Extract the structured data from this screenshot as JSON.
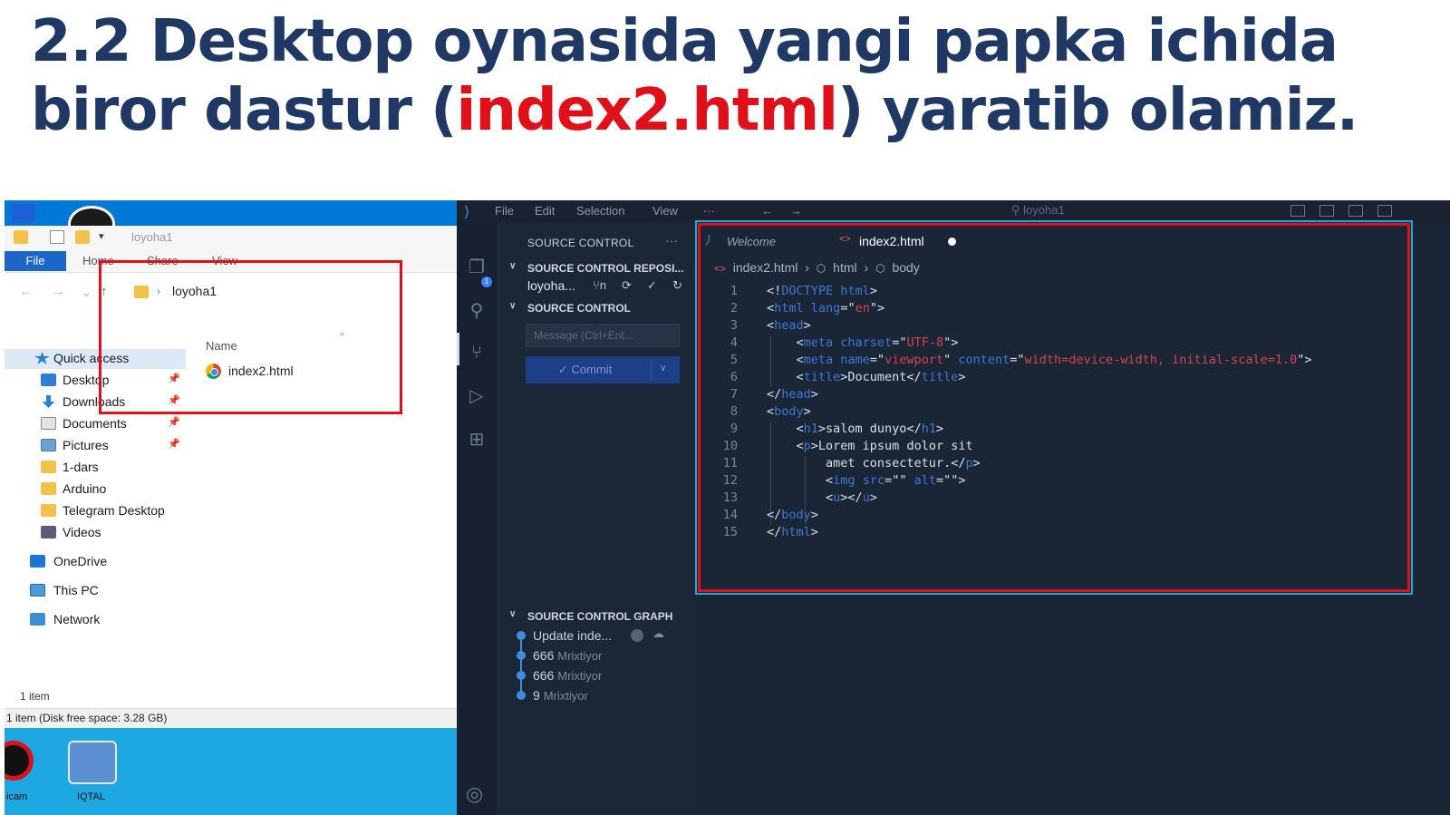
{
  "slide": {
    "title_part1": "2.2 Desktop oynasida yangi papka ichida biror dastur (",
    "title_highlight": "index2.html",
    "title_part2": ") yaratib olamiz."
  },
  "explorer": {
    "window_title": "loyoha1",
    "ribbon_tabs": [
      "File",
      "Home",
      "Share",
      "View"
    ],
    "address": "loyoha1",
    "sidebar": [
      {
        "label": "Quick access",
        "icon": "star-icon",
        "pinned": false
      },
      {
        "label": "Desktop",
        "icon": "desktop-icon",
        "pinned": true
      },
      {
        "label": "Downloads",
        "icon": "download-icon",
        "pinned": true
      },
      {
        "label": "Documents",
        "icon": "documents-icon",
        "pinned": true
      },
      {
        "label": "Pictures",
        "icon": "pictures-icon",
        "pinned": true
      },
      {
        "label": "1-dars",
        "icon": "folder-icon",
        "pinned": false
      },
      {
        "label": "Arduino",
        "icon": "folder-icon",
        "pinned": false
      },
      {
        "label": "Telegram Desktop",
        "icon": "folder-icon",
        "pinned": false
      },
      {
        "label": "Videos",
        "icon": "videos-icon",
        "pinned": false
      },
      {
        "label": "OneDrive",
        "icon": "onedrive-icon",
        "pinned": false
      },
      {
        "label": "This PC",
        "icon": "computer-icon",
        "pinned": false
      },
      {
        "label": "Network",
        "icon": "network-icon",
        "pinned": false
      }
    ],
    "column_header": "Name",
    "file_name": "index2.html",
    "item_count": "1 item",
    "status": "1 item (Disk free space: 3.28 GB)",
    "taskbar_labels": [
      "icam",
      "IQTAL"
    ]
  },
  "vscode": {
    "menu": [
      "File",
      "Edit",
      "Selection",
      "View",
      "···"
    ],
    "search": "loyoha1",
    "activity_badge": "1",
    "sidebar": {
      "header": "SOURCE CONTROL",
      "repos_section": "SOURCE CONTROL REPOSI...",
      "repo_name": "loyoha...",
      "repo_branch": "n",
      "sc_section": "SOURCE CONTROL",
      "message_placeholder": "Message (Ctrl+Ent...",
      "commit_label": "Commit",
      "graph_section": "SOURCE CONTROL GRAPH",
      "graph": [
        {
          "message": "Update inde...",
          "author": ""
        },
        {
          "message": "666",
          "author": "Mrixtiyor"
        },
        {
          "message": "666",
          "author": "Mrixtiyor"
        },
        {
          "message": "9",
          "author": "Mrixtiyor"
        }
      ]
    },
    "tabs": {
      "welcome": "Welcome",
      "active": "index2.html"
    },
    "breadcrumb": [
      "index2.html",
      "html",
      "body"
    ],
    "code": [
      [
        {
          "t": "<!",
          "c": "p"
        },
        {
          "t": "DOCTYPE html",
          "c": "tg"
        },
        {
          "t": ">",
          "c": "p"
        }
      ],
      [
        {
          "t": "<",
          "c": "p"
        },
        {
          "t": "html",
          "c": "tg"
        },
        {
          "t": " ",
          "c": "p"
        },
        {
          "t": "lang",
          "c": "at"
        },
        {
          "t": "=\"",
          "c": "p"
        },
        {
          "t": "en",
          "c": "st"
        },
        {
          "t": "\">",
          "c": "p"
        }
      ],
      [
        {
          "t": "<",
          "c": "p"
        },
        {
          "t": "head",
          "c": "tg"
        },
        {
          "t": ">",
          "c": "p"
        }
      ],
      [
        {
          "t": "    <",
          "c": "p"
        },
        {
          "t": "meta",
          "c": "tg"
        },
        {
          "t": " ",
          "c": "p"
        },
        {
          "t": "charset",
          "c": "at"
        },
        {
          "t": "=\"",
          "c": "p"
        },
        {
          "t": "UTF-8",
          "c": "st"
        },
        {
          "t": "\">",
          "c": "p"
        }
      ],
      [
        {
          "t": "    <",
          "c": "p"
        },
        {
          "t": "meta",
          "c": "tg"
        },
        {
          "t": " ",
          "c": "p"
        },
        {
          "t": "name",
          "c": "at"
        },
        {
          "t": "=\"",
          "c": "p"
        },
        {
          "t": "viewport",
          "c": "st"
        },
        {
          "t": "\" ",
          "c": "p"
        },
        {
          "t": "content",
          "c": "at"
        },
        {
          "t": "=\"",
          "c": "p"
        },
        {
          "t": "width=device-width, initial-scale=1.0",
          "c": "st"
        },
        {
          "t": "\">",
          "c": "p"
        }
      ],
      [
        {
          "t": "    <",
          "c": "p"
        },
        {
          "t": "title",
          "c": "tg"
        },
        {
          "t": ">Document</",
          "c": "p"
        },
        {
          "t": "title",
          "c": "tg"
        },
        {
          "t": ">",
          "c": "p"
        }
      ],
      [
        {
          "t": "</",
          "c": "p"
        },
        {
          "t": "head",
          "c": "tg"
        },
        {
          "t": ">",
          "c": "p"
        }
      ],
      [
        {
          "t": "<",
          "c": "p"
        },
        {
          "t": "body",
          "c": "tg"
        },
        {
          "t": ">",
          "c": "p"
        }
      ],
      [
        {
          "t": "    <",
          "c": "p"
        },
        {
          "t": "h1",
          "c": "tg"
        },
        {
          "t": ">salom dunyo</",
          "c": "p"
        },
        {
          "t": "h1",
          "c": "tg"
        },
        {
          "t": ">",
          "c": "p"
        }
      ],
      [
        {
          "t": "    <",
          "c": "p"
        },
        {
          "t": "p",
          "c": "tg"
        },
        {
          "t": ">Lorem ipsum dolor sit",
          "c": "p"
        }
      ],
      [
        {
          "t": "        amet consectetur.</",
          "c": "p"
        },
        {
          "t": "p",
          "c": "tg"
        },
        {
          "t": ">",
          "c": "p"
        }
      ],
      [
        {
          "t": "        <",
          "c": "p"
        },
        {
          "t": "img",
          "c": "tg"
        },
        {
          "t": " ",
          "c": "p"
        },
        {
          "t": "src",
          "c": "at"
        },
        {
          "t": "=\"\" ",
          "c": "p"
        },
        {
          "t": "alt",
          "c": "at"
        },
        {
          "t": "=\"\">",
          "c": "p"
        }
      ],
      [
        {
          "t": "        <",
          "c": "p"
        },
        {
          "t": "u",
          "c": "tg"
        },
        {
          "t": "></",
          "c": "p"
        },
        {
          "t": "u",
          "c": "tg"
        },
        {
          "t": ">",
          "c": "p"
        }
      ],
      [
        {
          "t": "</",
          "c": "p"
        },
        {
          "t": "body",
          "c": "tg"
        },
        {
          "t": ">",
          "c": "p"
        }
      ],
      [
        {
          "t": "</",
          "c": "p"
        },
        {
          "t": "html",
          "c": "tg"
        },
        {
          "t": ">",
          "c": "p"
        }
      ]
    ]
  },
  "colors": {
    "title": "#1f3864",
    "highlight": "#e0101a",
    "explorer_accent": "#0078d7",
    "vscode_bg": "#1b2636",
    "annotation": "#e0101a"
  }
}
